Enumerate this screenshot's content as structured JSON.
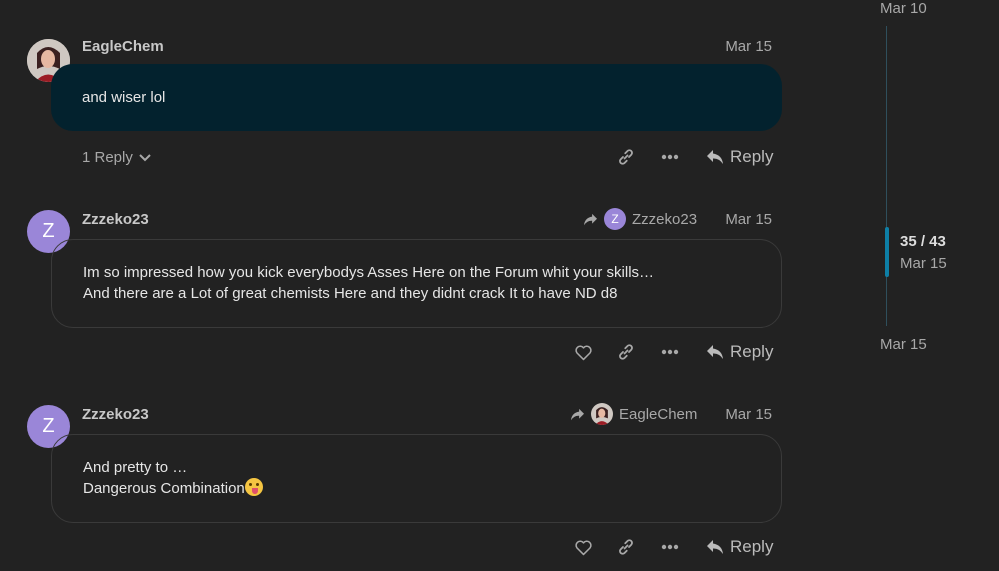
{
  "timeline": {
    "top_date": "Mar 10",
    "position": "35 / 43",
    "position_date": "Mar 15",
    "bottom_date": "Mar 15"
  },
  "posts": [
    {
      "username": "EagleChem",
      "date": "Mar 15",
      "lines": [
        "and wiser lol"
      ],
      "replies_label": "1 Reply",
      "reply_label": "Reply"
    },
    {
      "username": "Zzzeko23",
      "avatar_letter": "Z",
      "date": "Mar 15",
      "reply_to": "Zzzeko23",
      "reply_to_letter": "Z",
      "lines": [
        "Im so impressed how you kick everybodys Asses Here on the Forum whit your skills…",
        "And there are a Lot of great chemists Here and they didnt crack It to have ND d8"
      ],
      "reply_label": "Reply"
    },
    {
      "username": "Zzzeko23",
      "avatar_letter": "Z",
      "date": "Mar 15",
      "reply_to": "EagleChem",
      "lines": [
        "And pretty to …",
        "Dangerous Combination"
      ],
      "reply_label": "Reply"
    }
  ],
  "icons": {
    "link": "link-icon",
    "more": "more-icon",
    "like": "heart-icon",
    "reply": "reply-arrow-icon"
  },
  "colors": {
    "background": "#222222",
    "highlight": "#03222e",
    "accent": "#0e7fa6",
    "avatar_z": "#9a86d8"
  }
}
